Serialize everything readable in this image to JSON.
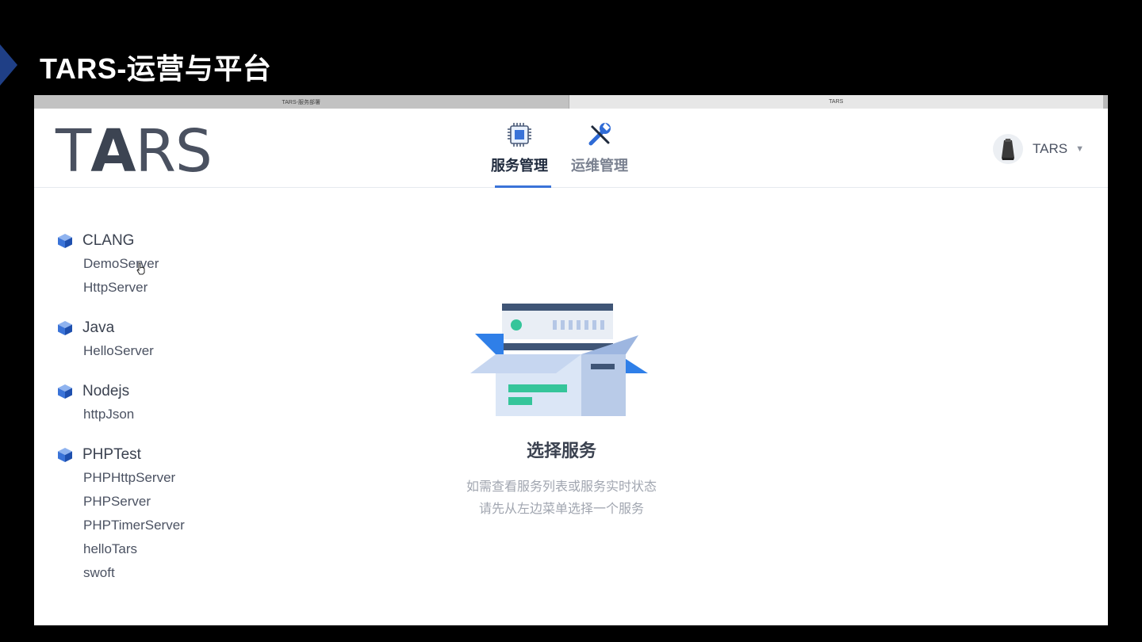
{
  "slide": {
    "title": "TARS-运营与平台"
  },
  "browser_tabs": [
    "TARS-服务部署",
    "TARS"
  ],
  "header": {
    "logo": {
      "thin": "T",
      "bold": "A",
      "thin2": "RS"
    },
    "nav": [
      {
        "label": "服务管理",
        "icon": "chip-icon",
        "active": true
      },
      {
        "label": "运维管理",
        "icon": "wrench-screwdriver-icon",
        "active": false
      }
    ],
    "user": {
      "name": "TARS",
      "caret": "▼"
    }
  },
  "sidebar": {
    "groups": [
      {
        "name": "CLANG",
        "servers": [
          "DemoServer",
          "HttpServer"
        ]
      },
      {
        "name": "Java",
        "servers": [
          "HelloServer"
        ]
      },
      {
        "name": "Nodejs",
        "servers": [
          "httpJson"
        ]
      },
      {
        "name": "PHPTest",
        "servers": [
          "PHPHttpServer",
          "PHPServer",
          "PHPTimerServer",
          "helloTars",
          "swoft"
        ]
      }
    ]
  },
  "empty_state": {
    "title": "选择服务",
    "line1": "如需查看服务列表或服务实时状态",
    "line2": "请先从左边菜单选择一个服务"
  },
  "colors": {
    "accent": "#3a73d8",
    "text": "#3b4250",
    "muted": "#a1a6b0"
  }
}
